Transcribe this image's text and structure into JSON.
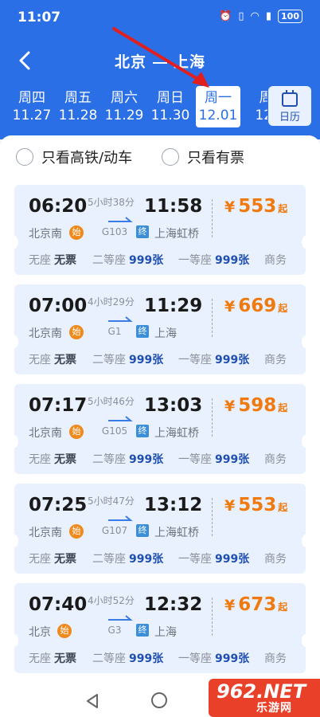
{
  "status": {
    "time": "11:07",
    "battery": "100",
    "icons": [
      "alarm-icon",
      "vibrate-icon",
      "wifi-icon",
      "signal-5g-icon",
      "battery-icon"
    ]
  },
  "header": {
    "from": "北京",
    "to": "上海",
    "back_icon": "back-arrow-icon"
  },
  "dates": [
    {
      "weekday": "周四",
      "date": "11.27"
    },
    {
      "weekday": "周五",
      "date": "11.28"
    },
    {
      "weekday": "周六",
      "date": "11.29"
    },
    {
      "weekday": "周日",
      "date": "11.30"
    },
    {
      "weekday": "周一",
      "date": "12.01",
      "selected": true
    },
    {
      "weekday": "周",
      "date": "12."
    }
  ],
  "calendar": {
    "label": "日历",
    "icon": "calendar-icon"
  },
  "filters": {
    "high_speed": "只看高铁/动车",
    "has_ticket": "只看有票"
  },
  "trains": [
    {
      "depart": "06:20",
      "arrive": "11:58",
      "duration": "5小时38分",
      "number": "G103",
      "from": "北京南",
      "to": "上海虹桥",
      "start_tag": "始",
      "end_tag": "终",
      "price": "553",
      "seats": [
        {
          "name": "无座",
          "value": "无票"
        },
        {
          "name": "二等座",
          "value": "999张"
        },
        {
          "name": "一等座",
          "value": "999张"
        },
        {
          "name": "商务",
          "value": ""
        }
      ]
    },
    {
      "depart": "07:00",
      "arrive": "11:29",
      "duration": "4小时29分",
      "number": "G1",
      "from": "北京南",
      "to": "上海",
      "start_tag": "始",
      "end_tag": "终",
      "price": "669",
      "seats": [
        {
          "name": "无座",
          "value": "无票"
        },
        {
          "name": "二等座",
          "value": "999张"
        },
        {
          "name": "一等座",
          "value": "999张"
        },
        {
          "name": "商务",
          "value": ""
        }
      ]
    },
    {
      "depart": "07:17",
      "arrive": "13:03",
      "duration": "5小时46分",
      "number": "G105",
      "from": "北京南",
      "to": "上海虹桥",
      "start_tag": "始",
      "end_tag": "终",
      "price": "598",
      "seats": [
        {
          "name": "无座",
          "value": "无票"
        },
        {
          "name": "二等座",
          "value": "999张"
        },
        {
          "name": "一等座",
          "value": "999张"
        },
        {
          "name": "商务",
          "value": ""
        }
      ]
    },
    {
      "depart": "07:25",
      "arrive": "13:12",
      "duration": "5小时47分",
      "number": "G107",
      "from": "北京南",
      "to": "上海虹桥",
      "start_tag": "始",
      "end_tag": "终",
      "price": "553",
      "seats": [
        {
          "name": "无座",
          "value": "无票"
        },
        {
          "name": "二等座",
          "value": "999张"
        },
        {
          "name": "一等座",
          "value": "999张"
        },
        {
          "name": "商务",
          "value": ""
        }
      ]
    },
    {
      "depart": "07:40",
      "arrive": "12:32",
      "duration": "4小时52分",
      "number": "G3",
      "from": "北京",
      "to": "上海",
      "start_tag": "始",
      "end_tag": "终",
      "price": "673",
      "seats": [
        {
          "name": "无座",
          "value": "无票"
        },
        {
          "name": "二等座",
          "value": "999张"
        },
        {
          "name": "一等座",
          "value": "999张"
        },
        {
          "name": "商务",
          "value": ""
        }
      ]
    }
  ],
  "price_currency": "¥",
  "price_suffix": "起",
  "watermark": {
    "big": "962.NET",
    "small": "乐游网"
  },
  "colors": {
    "primary": "#2b6fe6",
    "price": "#f07a0f",
    "card": "#e8f1fd",
    "annotation_arrow": "#e02020"
  }
}
